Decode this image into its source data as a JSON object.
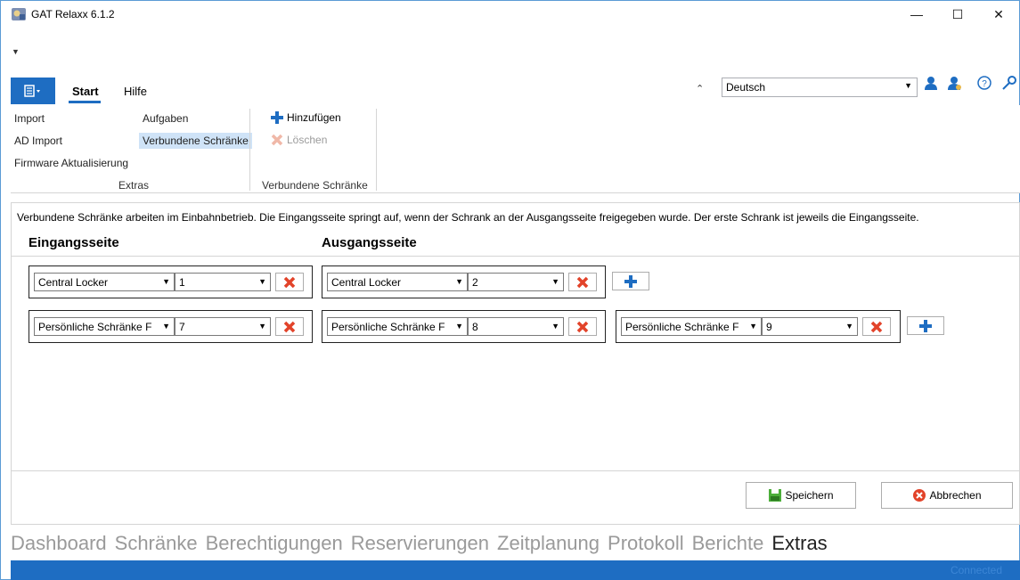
{
  "window": {
    "title": "GAT Relaxx 6.1.2",
    "minimize": "—",
    "maximize": "☐",
    "close": "✕"
  },
  "qat": "▼",
  "ribbon": {
    "tabs": [
      "Start",
      "Hilfe"
    ],
    "language": "Deutsch",
    "groups": {
      "extras": {
        "label": "Extras",
        "items": [
          "Import",
          "AD Import",
          "Firmware Aktualisierung",
          "Aufgaben",
          "Verbundene Schränke"
        ]
      },
      "verbundene": {
        "label": "Verbundene Schränke",
        "add": "Hinzufügen",
        "delete": "Löschen"
      }
    }
  },
  "content": {
    "info": "Verbundene Schränke arbeiten im Einbahnbetrieb. Die Eingangsseite springt auf, wenn der Schrank an der Ausgangsseite freigegeben wurde. Der erste Schrank ist jeweils die Eingangsseite.",
    "col_eingang": "Eingangsseite",
    "col_ausgang": "Ausgangsseite",
    "rows": [
      [
        {
          "cabinet": "Central Locker",
          "number": "1"
        },
        {
          "cabinet": "Central Locker",
          "number": "2"
        }
      ],
      [
        {
          "cabinet": "Persönliche Schränke F",
          "number": "7"
        },
        {
          "cabinet": "Persönliche Schränke F",
          "number": "8"
        },
        {
          "cabinet": "Persönliche Schränke F",
          "number": "9"
        }
      ]
    ],
    "save": "Speichern",
    "cancel": "Abbrechen"
  },
  "nav": [
    "Dashboard",
    "Schränke",
    "Berechtigungen",
    "Reservierungen",
    "Zeitplanung",
    "Protokoll",
    "Berichte",
    "Extras"
  ],
  "status": "Connected",
  "colors": {
    "accent": "#1e6dc2",
    "delete_red": "#e2432a",
    "add_blue": "#1e6dc2"
  }
}
